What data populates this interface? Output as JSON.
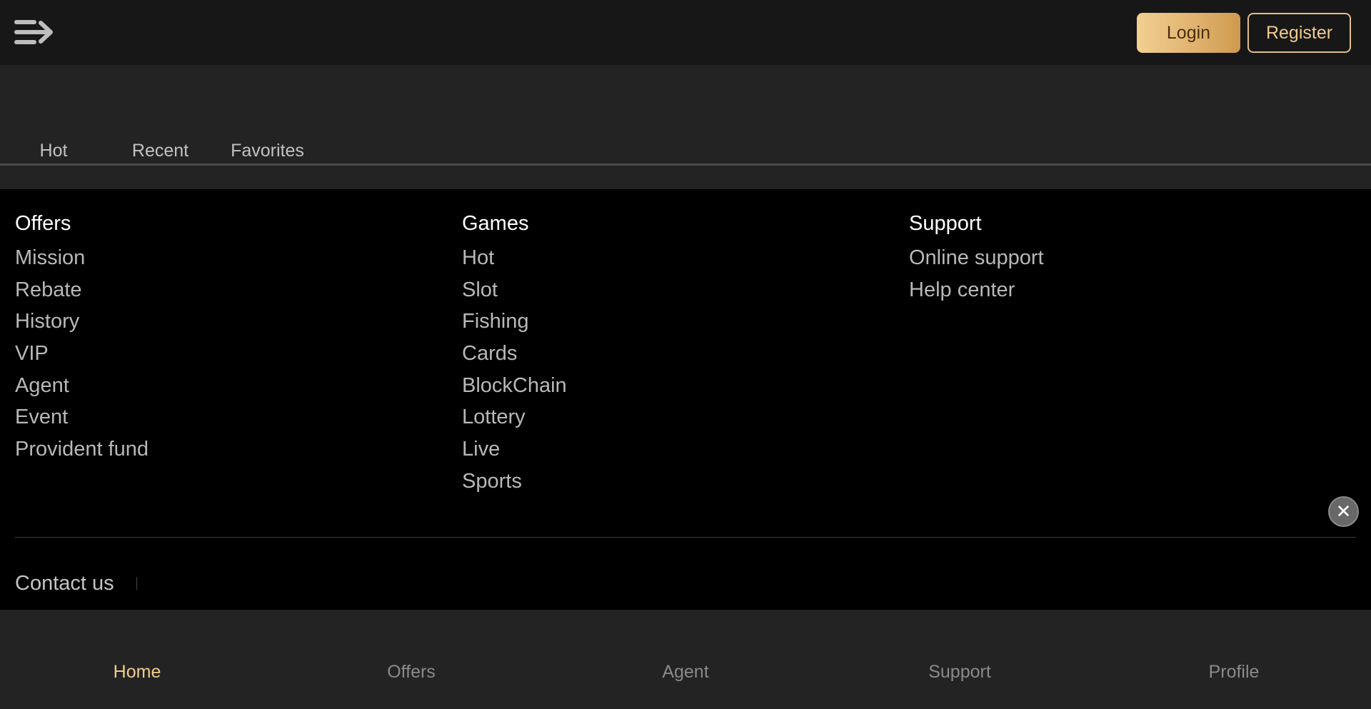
{
  "header": {
    "menu_icon": "collapse-menu-arrow-icon",
    "login_label": "Login",
    "register_label": "Register",
    "accent_color": "#e0b36f"
  },
  "tabs": [
    {
      "label": "Hot"
    },
    {
      "label": "Recent"
    },
    {
      "label": "Favorites"
    }
  ],
  "footer_menu": {
    "offers": {
      "title": "Offers",
      "items": [
        "Mission",
        "Rebate",
        "History",
        "VIP",
        "Agent",
        "Event",
        "Provident fund"
      ]
    },
    "games": {
      "title": "Games",
      "items": [
        "Hot",
        "Slot",
        "Fishing",
        "Cards",
        "BlockChain",
        "Lottery",
        "Live",
        "Sports"
      ]
    },
    "support": {
      "title": "Support",
      "items": [
        "Online support",
        "Help center"
      ]
    },
    "close_icon": "close-icon",
    "contact_label": "Contact us"
  },
  "bottom_nav": {
    "active_color": "#f0cc8c",
    "items": [
      {
        "label": "Home",
        "active": true
      },
      {
        "label": "Offers",
        "active": false
      },
      {
        "label": "Agent",
        "active": false
      },
      {
        "label": "Support",
        "active": false
      },
      {
        "label": "Profile",
        "active": false
      }
    ]
  }
}
